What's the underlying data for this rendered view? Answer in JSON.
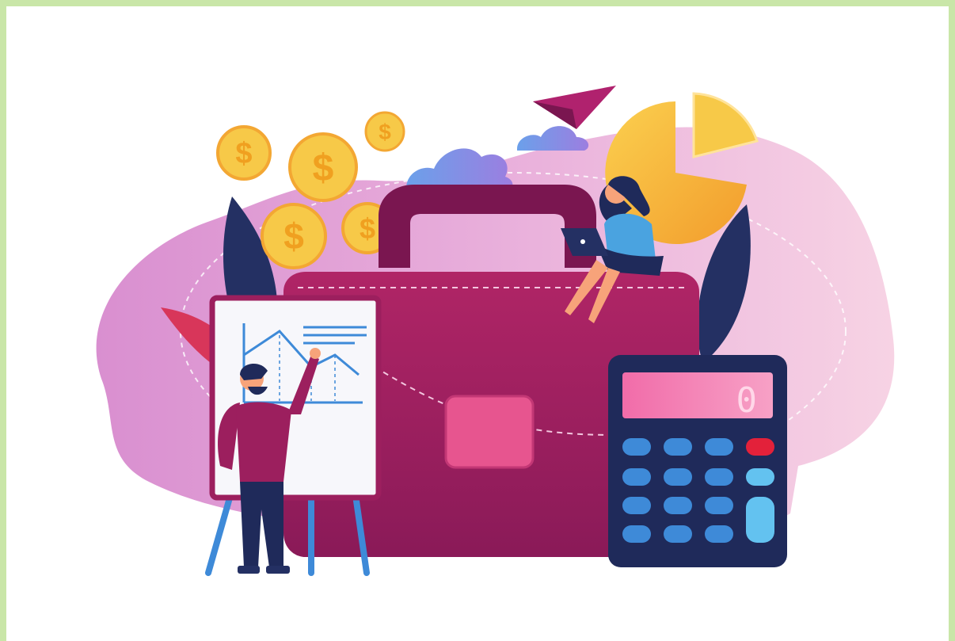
{
  "illustration": {
    "coin_symbol": "$",
    "calculator_display": "0",
    "colors": {
      "frame_border": "#c9e6a8",
      "background": "#ffffff",
      "blob_pink": "#f3c6df",
      "blob_purple": "#d98fd0",
      "briefcase": "#9c1f5e",
      "briefcase_dark": "#7a1650",
      "coin": "#f7c948",
      "pie_chart": "#f5b73a",
      "calculator_body": "#1f2a5a",
      "calculator_screen": "#f06aa8",
      "calculator_keys": "#3e8ad8",
      "calculator_red_key": "#e3213a",
      "paper_plane": "#b0226e",
      "cloud": "#5b8fe0",
      "leaf_dark": "#243063",
      "leaf_red": "#d8365a"
    }
  }
}
